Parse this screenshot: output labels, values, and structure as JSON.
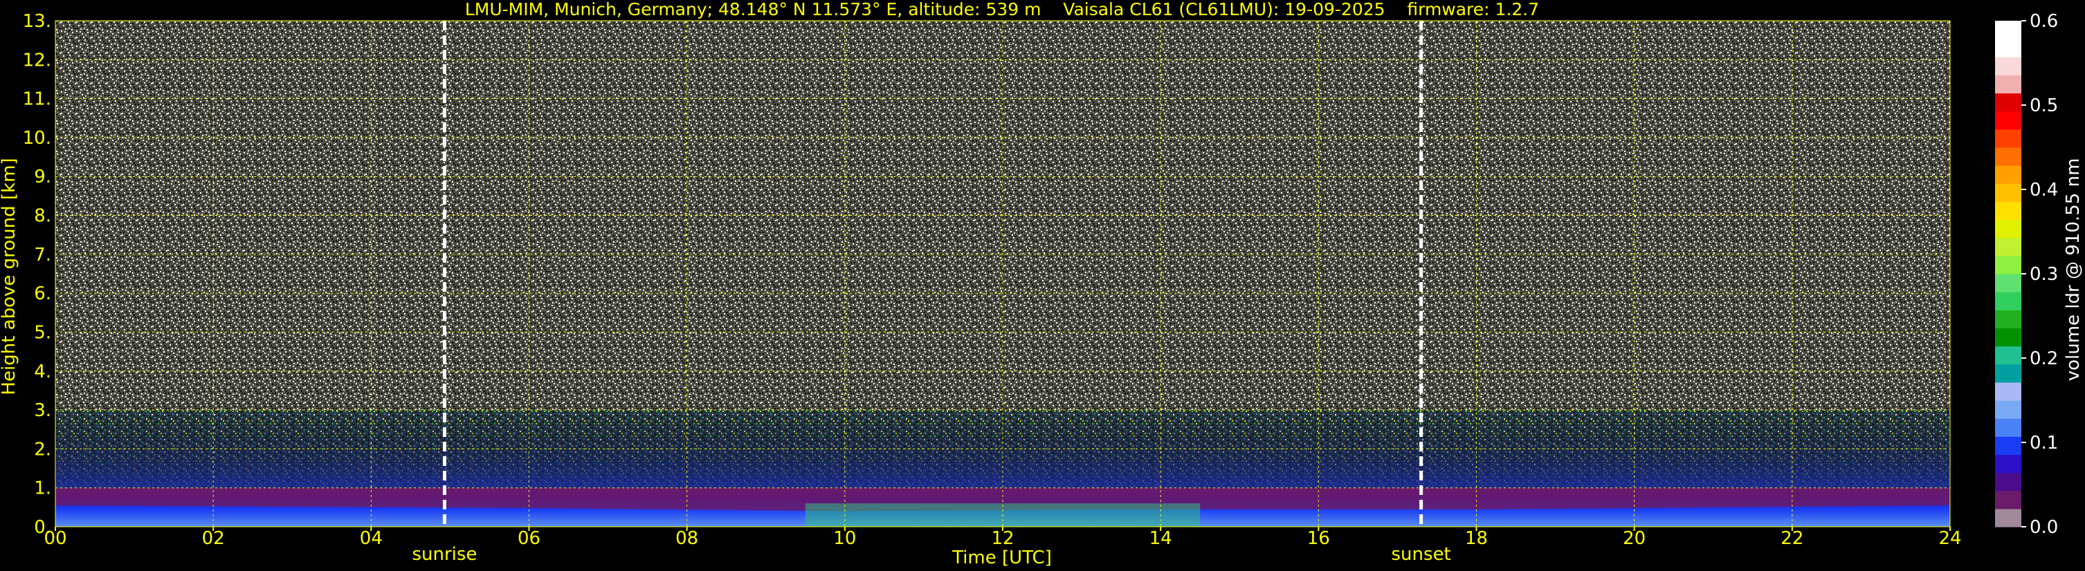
{
  "chart_data": {
    "type": "heatmap",
    "title": "LMU-MIM, Munich, Germany; 48.148° N 11.573° E, altitude: 539 m    Vaisala CL61 (CL61LMU): 19-09-2025    firmware: 1.2.7",
    "xlabel": "Time [UTC]",
    "ylabel": "Height above ground [km]",
    "xlim": [
      0,
      24
    ],
    "ylim": [
      0,
      13
    ],
    "x_ticks": [
      "00",
      "02",
      "04",
      "06",
      "08",
      "10",
      "12",
      "14",
      "16",
      "18",
      "20",
      "22",
      "24"
    ],
    "y_ticks": [
      "0.",
      "1.",
      "2.",
      "3.",
      "4.",
      "5.",
      "6.",
      "7.",
      "8.",
      "9.",
      "10.",
      "11.",
      "12.",
      "13."
    ],
    "grid": true,
    "grid_color": "#ffff00",
    "markers": [
      {
        "label": "sunrise",
        "x": 4.93
      },
      {
        "label": "sunset",
        "x": 17.3
      }
    ],
    "colorbar": {
      "label": "volume ldr @ 910.55 nm",
      "range": [
        0,
        0.6
      ],
      "ticks": [
        "0.0",
        "0.1",
        "0.2",
        "0.3",
        "0.4",
        "0.5",
        "0.6"
      ],
      "colors": [
        "#a08a9a",
        "#6a1b6a",
        "#4b0c8c",
        "#2a10c8",
        "#1a3cf5",
        "#4a82f5",
        "#7aaaf5",
        "#aab8f5",
        "#00a0a0",
        "#20c090",
        "#009000",
        "#20b020",
        "#30d060",
        "#60e070",
        "#90f040",
        "#c0f030",
        "#e0f000",
        "#ffe000",
        "#ffc000",
        "#ffa000",
        "#ff7000",
        "#ff4000",
        "#ff0000",
        "#e00000",
        "#f0b0b0",
        "#f8d8d8",
        "#ffffff",
        "#ffffff"
      ]
    },
    "layers": [
      {
        "name": "noise",
        "height_km": [
          3.0,
          13.0
        ]
      },
      {
        "name": "aerosol_transition",
        "height_km": [
          1.0,
          3.0
        ]
      },
      {
        "name": "boundary_layer",
        "height_km": [
          0.0,
          1.0
        ]
      }
    ],
    "low_ldr_region": {
      "x_range": [
        9.5,
        14.5
      ],
      "height_km": [
        0.0,
        0.6
      ]
    }
  }
}
